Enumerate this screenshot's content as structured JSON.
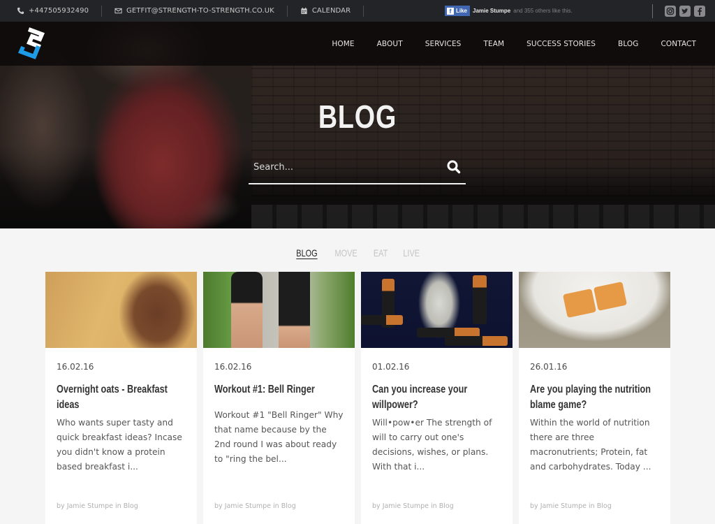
{
  "topbar": {
    "phone": "+447505932490",
    "email": "GETFIT@STRENGTH-TO-STRENGTH.CO.UK",
    "calendar": "CALENDAR",
    "facebook_like": {
      "button_label": "Like",
      "name": "Jamie Stumpe",
      "others_text": "and 355 others like this."
    },
    "social": [
      {
        "name": "instagram",
        "glyph": "◎"
      },
      {
        "name": "twitter",
        "glyph": "t"
      },
      {
        "name": "facebook",
        "glyph": "f"
      }
    ]
  },
  "nav": {
    "items": [
      "HOME",
      "ABOUT",
      "SERVICES",
      "TEAM",
      "SUCCESS STORIES",
      "BLOG",
      "CONTACT"
    ]
  },
  "hero": {
    "title": "BLOG",
    "search_placeholder": "Search..."
  },
  "filters": {
    "items": [
      "BLOG",
      "MOVE",
      "EAT",
      "LIVE"
    ],
    "active": "BLOG"
  },
  "posts": [
    {
      "date": "16.02.16",
      "title": "Overnight oats - Breakfast ideas",
      "excerpt": "Who wants super tasty and quick breakfast ideas? Incase you didn't know a protein based breakfast i...",
      "by": "by",
      "author": "Jamie Stumpe",
      "in": "in",
      "category": "Blog"
    },
    {
      "date": "16.02.16",
      "title": "Workout #1: Bell Ringer",
      "excerpt": "Workout #1 \"Bell Ringer\" Why that name because by the 2nd round I was about ready to \"ring the bel...",
      "by": "by",
      "author": "Jamie Stumpe",
      "in": "in",
      "category": "Blog"
    },
    {
      "date": "01.02.16",
      "title": "Can you increase your willpower?",
      "excerpt": "Will•pow•er The strength of will to carry out one's decisions, wishes, or plans.  With that i...",
      "by": "by",
      "author": "Jamie Stumpe",
      "in": "in",
      "category": "Blog"
    },
    {
      "date": "26.01.16",
      "title": "Are you playing the nutrition blame game?",
      "excerpt": "Within the world of nutrition there are three macronutrients; Protein, fat and carbohydrates. Today ...",
      "by": "by",
      "author": "Jamie Stumpe",
      "in": "in",
      "category": "Blog"
    }
  ],
  "colors": {
    "topbar_bg": "#232427",
    "logo_white": "#ffffff",
    "logo_blue": "#1e9be6",
    "facebook_blue": "#4267b2",
    "page_bg": "#f5f5f5"
  }
}
